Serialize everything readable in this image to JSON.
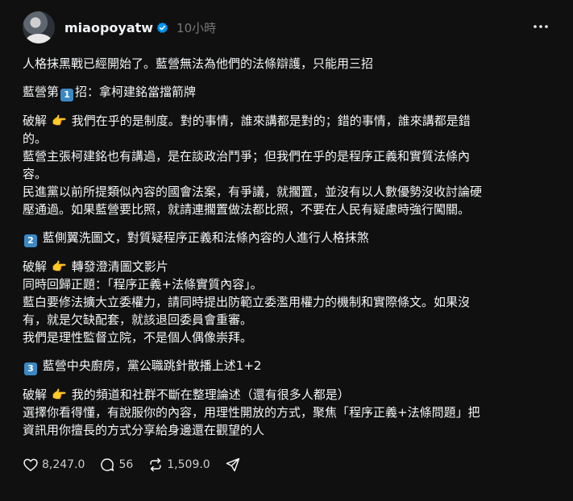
{
  "post": {
    "author": {
      "username": "miaopoyatw",
      "verified": true,
      "avatar_icon": "avatar-image"
    },
    "timestamp": "10小時",
    "lines": {
      "l1": "人格抹黑戰已經開始了。藍營無法為他們的法條辯護，只能用三招",
      "l2a": "藍營第",
      "l2key": "1",
      "l2b": "招：拿柯建銘當擋箭牌",
      "l3a": "破解",
      "l3b": "我們在乎的是制度。對的事情，誰來講都是對的；錯的事情，誰來講都是錯",
      "l4": "的。",
      "l5": "藍營主張柯建銘也有講過，是在談政治鬥爭；但我們在乎的是程序正義和實質法條內",
      "l6": "容。",
      "l7": "民進黨以前所提類似內容的國會法案，有爭議，就擱置，並沒有以人數優勢沒收討論硬",
      "l8": "壓通過。如果藍營要比照，就請連擱置做法都比照，不要在人民有疑慮時強行闖關。",
      "l9key": "2",
      "l9": "藍側翼洗圖文，對質疑程序正義和法條內容的人進行人格抹煞",
      "l10a": "破解",
      "l10b": "轉發澄清圖文影片",
      "l11": "同時回歸正題：「程序正義+法條實質內容」。",
      "l12": "藍白要修法擴大立委權力，請同時提出防範立委濫用權力的機制和實際條文。如果沒",
      "l13": "有，就是欠缺配套，就該退回委員會重審。",
      "l14": "我們是理性監督立院，不是個人偶像崇拜。",
      "l15key": "3",
      "l15": "藍營中央廚房，黨公職跳針散播上述1+2",
      "l16a": "破解",
      "l16b": "我的頻道和社群不斷在整理論述（還有很多人都是）",
      "l17": "選擇你看得懂，有說服你的內容，用理性開放的方式，聚焦「程序正義+法條問題」把",
      "l18": "資訊用你擅長的方式分享給身邊還在觀望的人"
    },
    "emoji": {
      "point": "👉"
    },
    "actions": {
      "like_count": "8,247.0",
      "comment_count": "56",
      "repost_count": "1,509.0",
      "like_icon": "heart-icon",
      "comment_icon": "comment-icon",
      "repost_icon": "repost-icon",
      "share_icon": "share-icon"
    },
    "colors": {
      "background": "#101010",
      "text": "#f3f5f7",
      "muted": "#777777",
      "verified": "#0095f6",
      "keycap": "#3b88c3"
    }
  }
}
